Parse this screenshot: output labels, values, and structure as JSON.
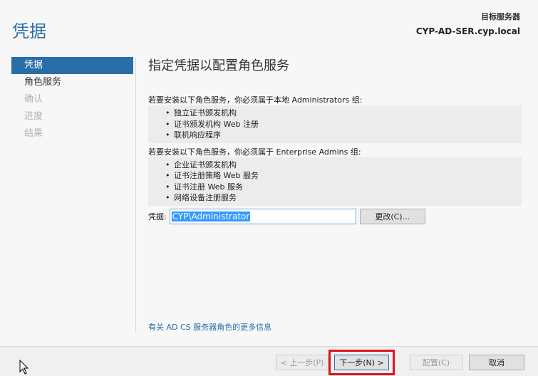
{
  "header": {
    "title": "凭据",
    "target_label": "目标服务器",
    "target_server": "CYP-AD-SER.cyp.local"
  },
  "sidebar": {
    "items": [
      {
        "label": "凭据",
        "state": "selected"
      },
      {
        "label": "角色服务",
        "state": "normal"
      },
      {
        "label": "确认",
        "state": "disabled"
      },
      {
        "label": "进度",
        "state": "disabled"
      },
      {
        "label": "结果",
        "state": "disabled"
      }
    ]
  },
  "main": {
    "section_title": "指定凭据以配置角色服务",
    "admins_text": "若要安装以下角色服务，你必须属于本地 Administrators 组:",
    "admins_list": [
      "独立证书颁发机构",
      "证书颁发机构 Web 注册",
      "联机响应程序"
    ],
    "enterprise_text": "若要安装以下角色服务，你必须属于 Enterprise Admins 组:",
    "enterprise_list": [
      "企业证书颁发机构",
      "证书注册策略 Web 服务",
      "证书注册 Web 服务",
      "网络设备注册服务"
    ],
    "credential_label": "凭据:",
    "credential_value": "CYP\\Administrator",
    "change_button": "更改(C)...",
    "more_info_link": "有关 AD CS 服务器角色的更多信息"
  },
  "footer": {
    "prev": "< 上一步(P)",
    "next": "下一步(N) >",
    "configure": "配置(C)",
    "cancel": "取消"
  },
  "colors": {
    "accent": "#2a6ea8",
    "highlight_border": "#e0121c",
    "selection": "#3399ff"
  }
}
